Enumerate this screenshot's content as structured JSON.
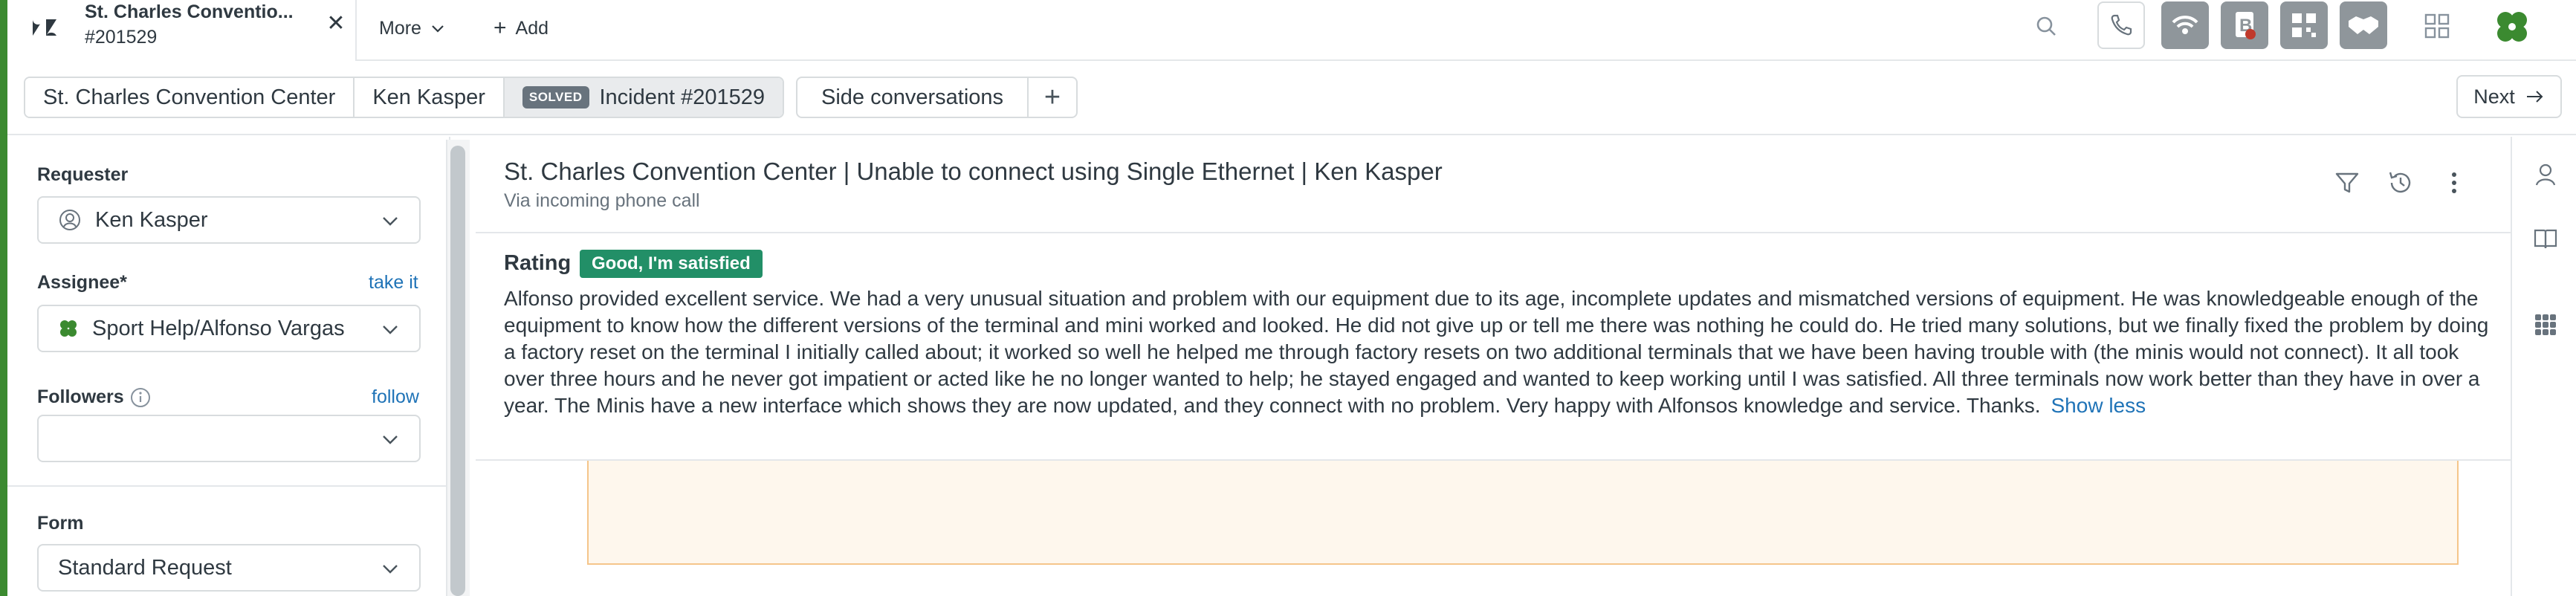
{
  "top_tab": {
    "title": "St. Charles Conventio...",
    "subtitle": "#201529"
  },
  "top_nav": {
    "more_label": "More",
    "add_label": "Add"
  },
  "breadcrumb": {
    "org": "St. Charles Convention Center",
    "user": "Ken Kasper",
    "status_badge": "SOLVED",
    "ticket": "Incident #201529"
  },
  "side_conversations": {
    "label": "Side conversations"
  },
  "next_label": "Next",
  "sidebar": {
    "requester_label": "Requester",
    "requester_value": "Ken Kasper",
    "assignee_label": "Assignee*",
    "take_it": "take it",
    "assignee_value": "Sport Help/Alfonso Vargas",
    "followers_label": "Followers",
    "follow_link": "follow",
    "followers_value": "",
    "form_label": "Form",
    "form_value": "Standard Request"
  },
  "ticket": {
    "title": "St. Charles Convention Center | Unable to connect using Single Ethernet | Ken Kasper",
    "via": "Via incoming phone call"
  },
  "rating": {
    "label": "Rating",
    "badge": "Good, I'm satisfied",
    "comment": "Alfonso provided excellent service. We had a very unusual situation and problem with our equipment due to its age, incomplete updates and mismatched versions of equipment. He was knowledgeable enough of the equipment to know how the different versions of the terminal and mini worked and looked. He did not give up or tell me there was nothing he could do. He tried many solutions, but we finally fixed the problem by doing a factory reset on the terminal I initially called about; it worked so well he helped me through factory resets on two additional terminals that we have been having trouble with (the minis would not connect). It all took over three hours and he never got impatient or acted like he no longer wanted to help; he stayed engaged and wanted to keep working until I was satisfied. All three terminals now work better than they have in over a year. The Minis have a new interface which shows they are now updated, and they connect with no problem. Very happy with Alfonsos knowledge and service. Thanks.",
    "show_less": "Show less"
  },
  "colors": {
    "brand_green": "#3b8a30",
    "link_blue": "#1f73b7",
    "rating_green": "#228f67",
    "note_bg": "#fef7ed"
  },
  "icons": {
    "search": "search-icon",
    "phone": "phone-icon",
    "wifi": "wifi-icon",
    "app1": "app-b-icon",
    "app2": "qr-app-icon",
    "app3": "handshake-icon",
    "apps": "grid-icon",
    "brand": "clover-logo-icon"
  }
}
